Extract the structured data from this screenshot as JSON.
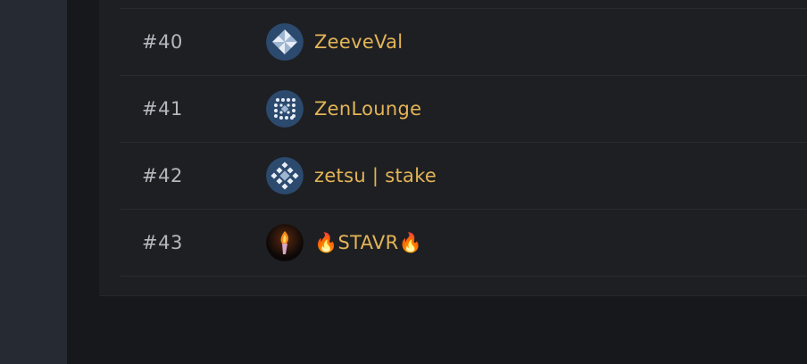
{
  "rows": [
    {
      "rank": "#40",
      "name": "ZeeveVal",
      "avatar_icon": "zeeve-pinwheel-icon"
    },
    {
      "rank": "#41",
      "name": "ZenLounge",
      "avatar_icon": "zenlounge-dots-icon"
    },
    {
      "rank": "#42",
      "name": "zetsu | stake",
      "avatar_icon": "zetsu-diamond-icon"
    },
    {
      "rank": "#43",
      "name": "🔥STAVR🔥",
      "avatar_icon": "stavr-torch-icon"
    }
  ],
  "colors": {
    "sidebar": "#262a32",
    "background": "#17181c",
    "card": "#1e1f23",
    "rank_text": "#b5b7be",
    "name_text": "#e3b556",
    "avatar_bg": "#2c4a6e"
  }
}
